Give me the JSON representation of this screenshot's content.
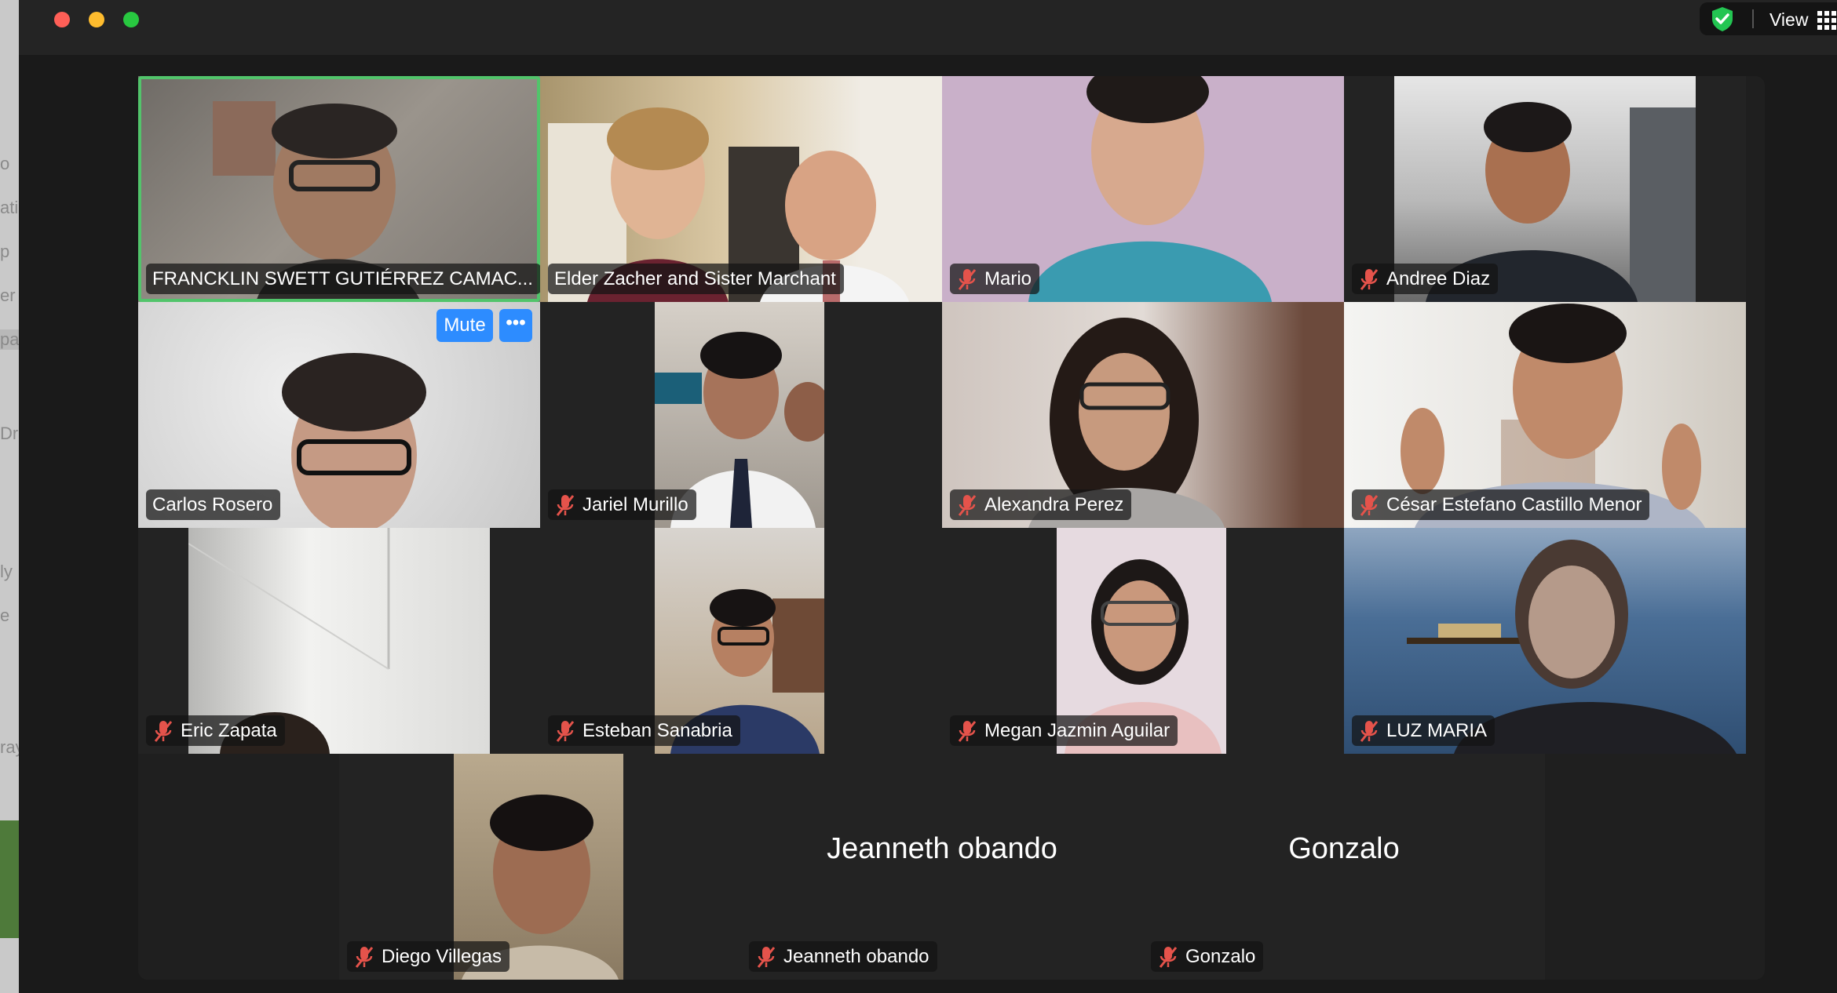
{
  "toolbar": {
    "view_label": "View",
    "security_icon": "shield-check-icon",
    "view_icon": "grid-icon"
  },
  "colors": {
    "active_speaker_border": "#52c46b",
    "mute_button": "#2d8cff",
    "muted_mic": "#e5534b",
    "window_bg": "#1a1a1a"
  },
  "hover_controls": {
    "mute_label": "Mute",
    "more_label": "•••"
  },
  "participants": [
    {
      "name": "FRANCKLIN SWETT GUTIÉRREZ CAMAC...",
      "muted": false,
      "video": true,
      "active_speaker": true
    },
    {
      "name": "Elder Zacher and Sister Marchant",
      "muted": false,
      "video": true
    },
    {
      "name": "Mario",
      "muted": true,
      "video": true
    },
    {
      "name": "Andree Diaz",
      "muted": true,
      "video": true
    },
    {
      "name": "Carlos Rosero",
      "muted": false,
      "video": true
    },
    {
      "name": "Jariel Murillo",
      "muted": true,
      "video": true
    },
    {
      "name": "Alexandra Perez",
      "muted": true,
      "video": true
    },
    {
      "name": "César Estefano Castillo Menor",
      "muted": true,
      "video": true
    },
    {
      "name": "Eric Zapata",
      "muted": true,
      "video": true
    },
    {
      "name": "Esteban Sanabria",
      "muted": true,
      "video": true
    },
    {
      "name": "Megan Jazmin Aguilar",
      "muted": true,
      "video": true
    },
    {
      "name": "LUZ MARIA",
      "muted": true,
      "video": true
    },
    {
      "name": "Diego Villegas",
      "muted": true,
      "video": true
    },
    {
      "name": "Jeanneth obando",
      "muted": true,
      "video": false
    },
    {
      "name": "Gonzalo",
      "muted": true,
      "video": false
    }
  ],
  "background_window_fragments": [
    "o",
    "ati",
    "p",
    "er",
    "pa",
    "Dr",
    "ly",
    "e",
    "ray"
  ]
}
